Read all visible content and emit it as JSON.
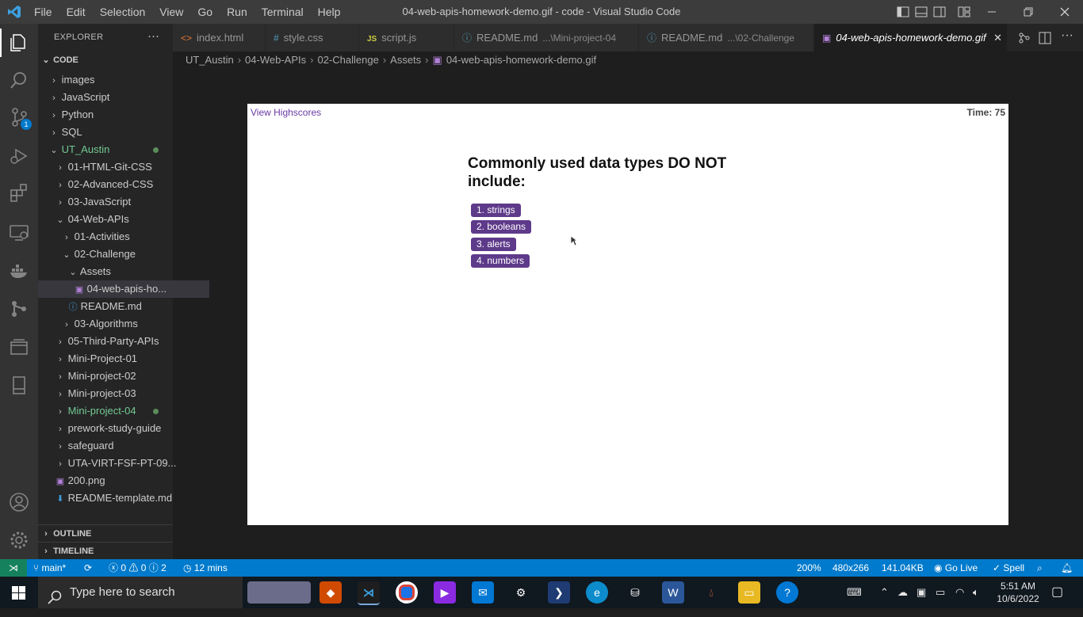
{
  "window": {
    "title": "04-web-apis-homework-demo.gif - code - Visual Studio Code",
    "menu": [
      "File",
      "Edit",
      "Selection",
      "View",
      "Go",
      "Run",
      "Terminal",
      "Help"
    ]
  },
  "activity": {
    "scm_badge": "1"
  },
  "sidebar": {
    "header": "EXPLORER",
    "more": "···",
    "section": "CODE",
    "outline": "OUTLINE",
    "timeline": "TIMELINE",
    "tree": [
      {
        "label": "images",
        "chev": "›"
      },
      {
        "label": "JavaScript",
        "chev": "›"
      },
      {
        "label": "Python",
        "chev": "›"
      },
      {
        "label": "SQL",
        "chev": "›"
      },
      {
        "label": "UT_Austin",
        "chev": "⌄"
      },
      {
        "label": "01-HTML-Git-CSS",
        "chev": "›"
      },
      {
        "label": "02-Advanced-CSS",
        "chev": "›"
      },
      {
        "label": "03-JavaScript",
        "chev": "›"
      },
      {
        "label": "04-Web-APIs",
        "chev": "⌄"
      },
      {
        "label": "01-Activities",
        "chev": "›"
      },
      {
        "label": "02-Challenge",
        "chev": "⌄"
      },
      {
        "label": "Assets",
        "chev": "⌄"
      },
      {
        "label": "04-web-apis-ho...",
        "chev": ""
      },
      {
        "label": "README.md",
        "chev": ""
      },
      {
        "label": "03-Algorithms",
        "chev": "›"
      },
      {
        "label": "05-Third-Party-APIs",
        "chev": "›"
      },
      {
        "label": "Mini-Project-01",
        "chev": "›"
      },
      {
        "label": "Mini-project-02",
        "chev": "›"
      },
      {
        "label": "Mini-project-03",
        "chev": "›"
      },
      {
        "label": "Mini-project-04",
        "chev": "›"
      },
      {
        "label": "prework-study-guide",
        "chev": "›"
      },
      {
        "label": "safeguard",
        "chev": "›"
      },
      {
        "label": "UTA-VIRT-FSF-PT-09...",
        "chev": "›"
      },
      {
        "label": "200.png",
        "chev": ""
      },
      {
        "label": "README-template.md",
        "chev": ""
      }
    ]
  },
  "tabs": [
    {
      "label": "index.html",
      "icon": "<>",
      "hint": ""
    },
    {
      "label": "style.css",
      "icon": "#",
      "hint": ""
    },
    {
      "label": "script.js",
      "icon": "JS",
      "hint": ""
    },
    {
      "label": "README.md",
      "icon": "ⓘ",
      "hint": "...\\Mini-project-04"
    },
    {
      "label": "README.md",
      "icon": "ⓘ",
      "hint": "...\\02-Challenge"
    },
    {
      "label": "04-web-apis-homework-demo.gif",
      "icon": "▣",
      "hint": ""
    }
  ],
  "breadcrumb": [
    "UT_Austin",
    "04-Web-APIs",
    "02-Challenge",
    "Assets",
    "04-web-apis-homework-demo.gif"
  ],
  "preview": {
    "view_highscores": "View Highscores",
    "timer": "Time: 75",
    "question": "Commonly used data types DO NOT include:",
    "answers": [
      "1. strings",
      "2. booleans",
      "3. alerts",
      "4. numbers"
    ]
  },
  "status": {
    "branch": "main*",
    "errors": "0",
    "warnings": "0",
    "info": "2",
    "time": "12 mins",
    "zoom": "200%",
    "dims": "480x266",
    "size": "141.04KB",
    "golive": "Go Live",
    "spell": "Spell"
  },
  "taskbar": {
    "search_placeholder": "Type here to search",
    "time": "5:51 AM",
    "date": "10/6/2022"
  },
  "colors": {
    "accent": "#007acc",
    "answer_bg": "#5e3a8a",
    "git_modified": "#73c991"
  }
}
